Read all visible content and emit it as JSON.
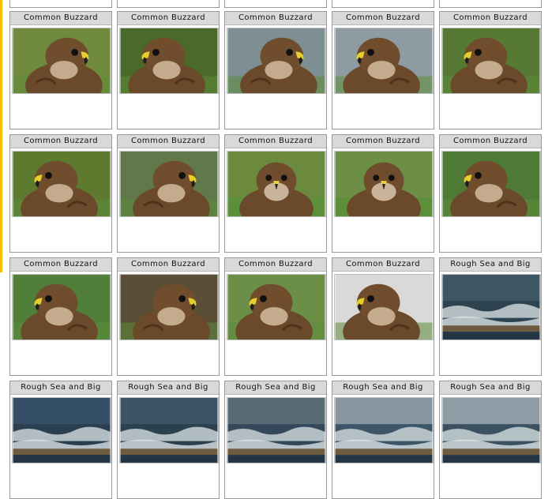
{
  "gallery": {
    "columns": 5,
    "photos": [
      {
        "title": "",
        "kind": "blank"
      },
      {
        "title": "",
        "kind": "blank"
      },
      {
        "title": "",
        "kind": "blank"
      },
      {
        "title": "",
        "kind": "blank"
      },
      {
        "title": "",
        "kind": "blank"
      },
      {
        "title": "Common Buzzard",
        "kind": "buzzard",
        "bg": "#6f8a3d",
        "face": "right"
      },
      {
        "title": "Common Buzzard",
        "kind": "buzzard",
        "bg": "#4b6a2a",
        "face": "left"
      },
      {
        "title": "Common Buzzard",
        "kind": "buzzard",
        "bg": "#7d8f92",
        "face": "right"
      },
      {
        "title": "Common Buzzard",
        "kind": "buzzard",
        "bg": "#8f9ba3",
        "face": "left"
      },
      {
        "title": "Common Buzzard",
        "kind": "buzzard",
        "bg": "#567a33",
        "face": "left"
      },
      {
        "title": "Common Buzzard",
        "kind": "buzzard",
        "bg": "#5d7a2f",
        "face": "left"
      },
      {
        "title": "Common Buzzard",
        "kind": "buzzard",
        "bg": "#60784a",
        "face": "right"
      },
      {
        "title": "Common Buzzard",
        "kind": "buzzard",
        "bg": "#6b8a3e",
        "face": "front"
      },
      {
        "title": "Common Buzzard",
        "kind": "buzzard",
        "bg": "#6d8f45",
        "face": "front"
      },
      {
        "title": "Common Buzzard",
        "kind": "buzzard",
        "bg": "#4f7a36",
        "face": "left"
      },
      {
        "title": "Common Buzzard",
        "kind": "buzzard",
        "bg": "#4f7f38",
        "face": "left"
      },
      {
        "title": "Common Buzzard",
        "kind": "buzzard",
        "bg": "#5a4f36",
        "face": "right"
      },
      {
        "title": "Common Buzzard",
        "kind": "buzzard",
        "bg": "#6c8f47",
        "face": "left"
      },
      {
        "title": "Common Buzzard",
        "kind": "buzzard",
        "bg": "#d9d9d9",
        "face": "left"
      },
      {
        "title": "Rough Sea and Big",
        "kind": "sea",
        "sky": "#3e5663",
        "sea": "#2e4350"
      },
      {
        "title": "Rough Sea and Big",
        "kind": "sea",
        "sky": "#355066",
        "sea": "#2a3f4f"
      },
      {
        "title": "Rough Sea and Big",
        "kind": "sea",
        "sky": "#3c5566",
        "sea": "#2c4150"
      },
      {
        "title": "Rough Sea and Big",
        "kind": "sea",
        "sky": "#596b73",
        "sea": "#33485a"
      },
      {
        "title": "Rough Sea and Big",
        "kind": "sea",
        "sky": "#8797a1",
        "sea": "#3d5568"
      },
      {
        "title": "Rough Sea and Big",
        "kind": "sea",
        "sky": "#8f9ca5",
        "sea": "#3a5162"
      }
    ]
  }
}
